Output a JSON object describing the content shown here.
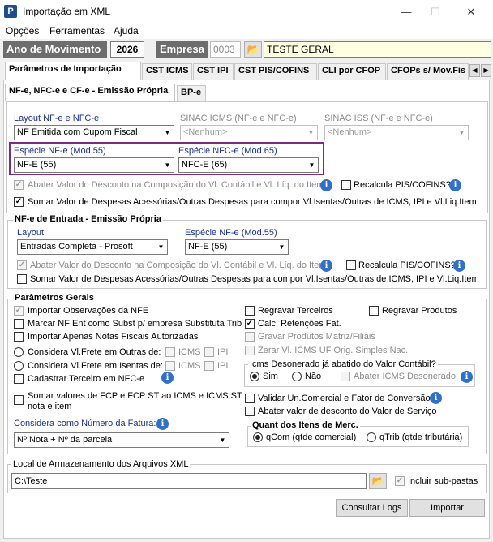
{
  "window": {
    "title": "Importação em XML",
    "minimize": "—",
    "maximize": "☐",
    "close": "✕"
  },
  "menu": [
    "Opções",
    "Ferramentas",
    "Ajuda"
  ],
  "top": {
    "ano_label": "Ano de Movimento",
    "ano_value": "2026",
    "empresa_label": "Empresa",
    "empresa_code": "0003",
    "empresa_name": "TESTE GERAL"
  },
  "tabs": [
    "Parâmetros de Importação",
    "CST ICMS",
    "CST IPI",
    "CST PIS/COFINS",
    "CLI por CFOP",
    "CFOPs s/ Mov.Fís"
  ],
  "subtabs": [
    "NF-e, NFC-e e CF-e - Emissão Própria",
    "BP-e"
  ],
  "saida": {
    "layout_label": "Layout NF-e e NFC-e",
    "layout_value": "NF Emitida com Cupom Fiscal",
    "sinac_icms_label": "SINAC ICMS (NF-e e NFC-e)",
    "sinac_icms_value": "<Nenhum>",
    "sinac_iss_label": "SINAC ISS (NF-e e NFC-e)",
    "sinac_iss_value": "<Nenhum>",
    "especie_nfe_label": "Espécie NF-e (Mod.55)",
    "especie_nfe_value": "NF-E (55)",
    "especie_nfce_label": "Espécie NFC-e (Mod.65)",
    "especie_nfce_value": "NFC-E (65)",
    "abater_label": "Abater Valor do Desconto na Composição do Vl. Contábil e Vl. Líq. do Item",
    "recalcula_label": "Recalcula PIS/COFINS?",
    "somar_label": "Somar Valor de Despesas Acessórias/Outras Despesas para compor Vl.Isentas/Outras de ICMS, IPI e Vl.Liq.Item"
  },
  "entrada": {
    "title": "NF-e de Entrada - Emissão Própria",
    "layout_label": "Layout",
    "layout_value": "Entradas Completa - Prosoft",
    "especie_label": "Espécie NF-e (Mod.55)",
    "especie_value": "NF-E (55)",
    "abater_label": "Abater Valor do Desconto na Composição do Vl. Contábil e Vl. Líq. do Item",
    "recalcula_label": "Recalcula PIS/COFINS?",
    "somar_label": "Somar Valor de Despesas Acessórias/Outras Despesas para compor Vl.Isentas/Outras de ICMS, IPI e Vl.Liq.Item"
  },
  "gerais": {
    "title": "Parâmetros Gerais",
    "importar_obs": "Importar Observações da NFE",
    "marcar_nf": "Marcar NF Ent como Subst p/ empresa Substituta Trib",
    "importar_aut": "Importar Apenas Notas Fiscais Autorizadas",
    "frete_outras": "Considera Vl.Frete em Outras de:",
    "frete_isentas": "Considera Vl.Frete em Isentas de:",
    "icms": "ICMS",
    "ipi": "IPI",
    "cadastrar": "Cadastrar Terceiro em NFC-e",
    "somar_fcp_1": "Somar valores de FCP e FCP ST ao ICMS e ICMS ST",
    "somar_fcp_2": "nota e item",
    "fatura_label": "Considera como Número da Fatura:",
    "fatura_value": "Nº Nota + Nº da parcela",
    "regravar_terceiros": "Regravar Terceiros",
    "regravar_produtos": "Regravar Produtos",
    "calc_retencoes": "Calc. Retenções Fat.",
    "gravar_matriz": "Gravar Produtos Matriz/Filiais",
    "zerar_icms": "Zerar Vl. ICMS UF Orig. Simples Nac.",
    "deson_title": "Icms Desonerado já abatido do Valor Contábil?",
    "sim": "Sim",
    "nao": "Não",
    "abater_deson": "Abater ICMS Desonerado",
    "validar": "Validar Un.Comercial e Fator de Conversão",
    "abater_servico": "Abater valor de desconto do Valor de Serviço",
    "quant_title": "Quant dos Itens de Merc.",
    "qcom": "qCom (qtde comercial)",
    "qtrib": "qTrib (qtde tributária)"
  },
  "local": {
    "title": "Local de Armazenamento dos Arquivos XML",
    "path": "C:\\Teste",
    "subpastas": "Incluir sub-pastas"
  },
  "buttons": {
    "logs": "Consultar Logs",
    "importar": "Importar"
  },
  "colors": {
    "accent_border": "#7b2a86",
    "label_blue": "#1a2fa0"
  }
}
